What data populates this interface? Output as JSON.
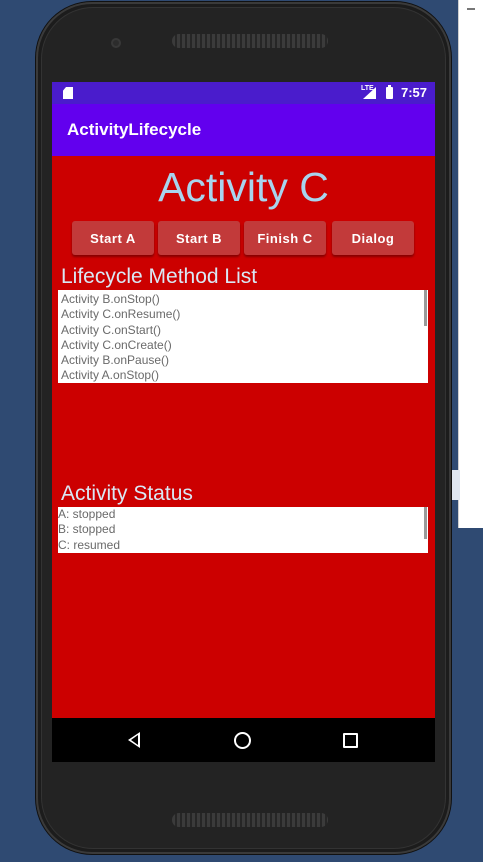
{
  "status_bar": {
    "time": "7:57",
    "network": "LTE",
    "icons": [
      "sd-card-icon",
      "signal-icon",
      "battery-icon"
    ]
  },
  "app_bar": {
    "title": "ActivityLifecycle"
  },
  "activity": {
    "title": "Activity C"
  },
  "buttons": {
    "start_a": "Start A",
    "start_b": "Start B",
    "finish_c": "Finish C",
    "dialog": "Dialog"
  },
  "lifecycle": {
    "heading": "Lifecycle Method List",
    "items": [
      "Activity B.onStop()",
      "Activity C.onResume()",
      "Activity C.onStart()",
      "Activity C.onCreate()",
      "Activity B.onPause()",
      "Activity A.onStop()"
    ]
  },
  "status": {
    "heading": "Activity Status",
    "items": [
      "A: stopped",
      "B: stopped",
      "C: resumed"
    ]
  },
  "nav": {
    "icons": [
      "back-icon",
      "home-icon",
      "recents-icon"
    ]
  },
  "colors": {
    "status_bar": "#4a1ccc",
    "app_bar": "#6200ee",
    "screen_background": "#cc0000",
    "button": "#c23a3a",
    "title_text": "#a8d4ee"
  }
}
